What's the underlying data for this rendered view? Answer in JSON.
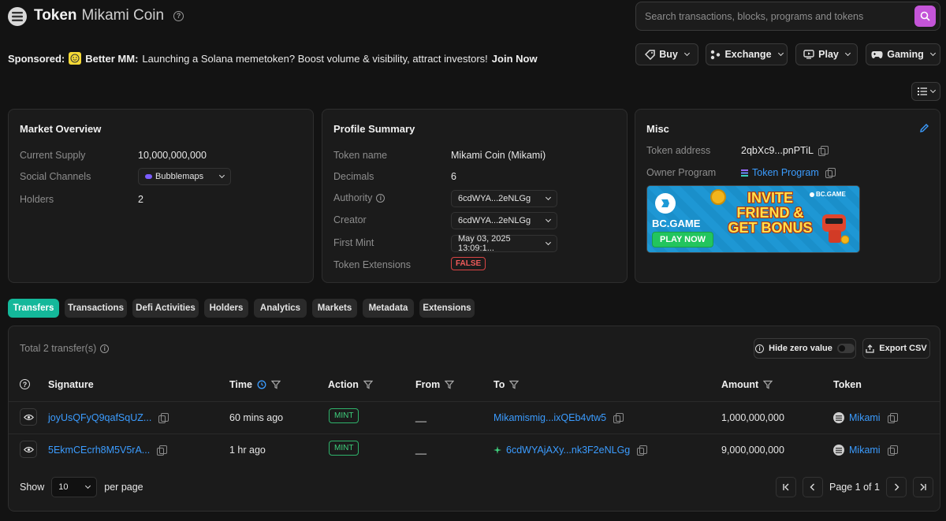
{
  "header": {
    "title": "Token",
    "subtitle": "Mikami Coin",
    "search_placeholder": "Search transactions, blocks, programs and tokens"
  },
  "sponsor": {
    "label": "Sponsored:",
    "brand": "Better MM:",
    "text": "Launching a Solana memetoken? Boost volume & visibility, attract investors!",
    "cta": "Join Now"
  },
  "nav": {
    "buy": "Buy",
    "exchange": "Exchange",
    "play": "Play",
    "gaming": "Gaming"
  },
  "market": {
    "title": "Market Overview",
    "supply_label": "Current Supply",
    "supply_value": "10,000,000,000",
    "social_label": "Social Channels",
    "social_value": "Bubblemaps",
    "holders_label": "Holders",
    "holders_value": "2"
  },
  "profile": {
    "title": "Profile Summary",
    "name_label": "Token name",
    "name_value": "Mikami Coin (Mikami)",
    "decimals_label": "Decimals",
    "decimals_value": "6",
    "authority_label": "Authority",
    "authority_value": "6cdWYA...2eNLGg",
    "creator_label": "Creator",
    "creator_value": "6cdWYA...2eNLGg",
    "firstmint_label": "First Mint",
    "firstmint_value": "May 03, 2025 13:09:1...",
    "ext_label": "Token Extensions",
    "ext_value": "FALSE"
  },
  "misc": {
    "title": "Misc",
    "address_label": "Token address",
    "address_value": "2qbXc9...pnPTiL",
    "owner_label": "Owner Program",
    "owner_value": "Token Program",
    "ad": {
      "brand": "BC.GAME",
      "headline1": "INVITE",
      "headline2": "FRIEND &",
      "headline3": "GET BONUS",
      "cta": "PLAY NOW"
    }
  },
  "tabs": [
    "Transfers",
    "Transactions",
    "Defi Activities",
    "Holders",
    "Analytics",
    "Markets",
    "Metadata",
    "Extensions"
  ],
  "transfers": {
    "total": "Total 2 transfer(s)",
    "hide_zero": "Hide zero value",
    "export": "Export CSV",
    "columns": {
      "signature": "Signature",
      "time": "Time",
      "action": "Action",
      "from": "From",
      "to": "To",
      "amount": "Amount",
      "token": "Token"
    },
    "rows": [
      {
        "signature": "joyUsQFyQ9qafSqUZ...",
        "time": "60 mins ago",
        "action": "MINT",
        "from": "__",
        "to": "Mikamismig...ixQEb4vtw5",
        "amount": "1,000,000,000",
        "token": "Mikami"
      },
      {
        "signature": "5EkmCEcrh8M5V5rA...",
        "time": "1 hr ago",
        "action": "MINT",
        "from": "__",
        "to": "6cdWYAjAXy...nk3F2eNLGg",
        "amount": "9,000,000,000",
        "token": "Mikami"
      }
    ],
    "show_label": "Show",
    "page_size": "10",
    "per_page": "per page",
    "page_info": "Page 1 of 1"
  }
}
